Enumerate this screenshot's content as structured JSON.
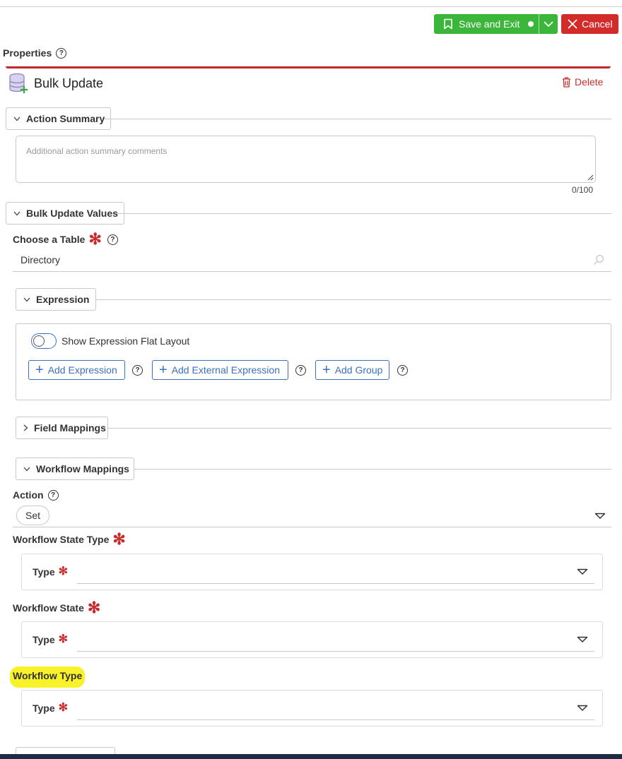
{
  "toolbar": {
    "save_label": "Save and Exit",
    "cancel_label": "Cancel",
    "save_color": "#3bb53a",
    "cancel_color": "#d32a2a"
  },
  "properties": {
    "title": "Properties"
  },
  "action": {
    "title": "Bulk Update",
    "delete_label": "Delete",
    "accent_color": "#c0282d"
  },
  "action_summary": {
    "label": "Action Summary",
    "placeholder": "Additional action summary comments",
    "counter": "0/100"
  },
  "bulk_update_values": {
    "label": "Bulk Update Values",
    "choose_table_label": "Choose a Table",
    "choose_table_value": "Directory"
  },
  "expression": {
    "label": "Expression",
    "toggle_label": "Show Expression Flat Layout",
    "add_expression": "Add Expression",
    "add_external_expression": "Add External Expression",
    "add_group": "Add Group"
  },
  "field_mappings": {
    "label": "Field Mappings"
  },
  "workflow_mappings": {
    "label": "Workflow Mappings",
    "action_label": "Action",
    "action_value": "Set",
    "state_type_label": "Workflow State Type",
    "state_label": "Workflow State",
    "workflow_type_label": "Workflow Type",
    "type_label": "Type",
    "highlight_color": "#f7f229"
  }
}
